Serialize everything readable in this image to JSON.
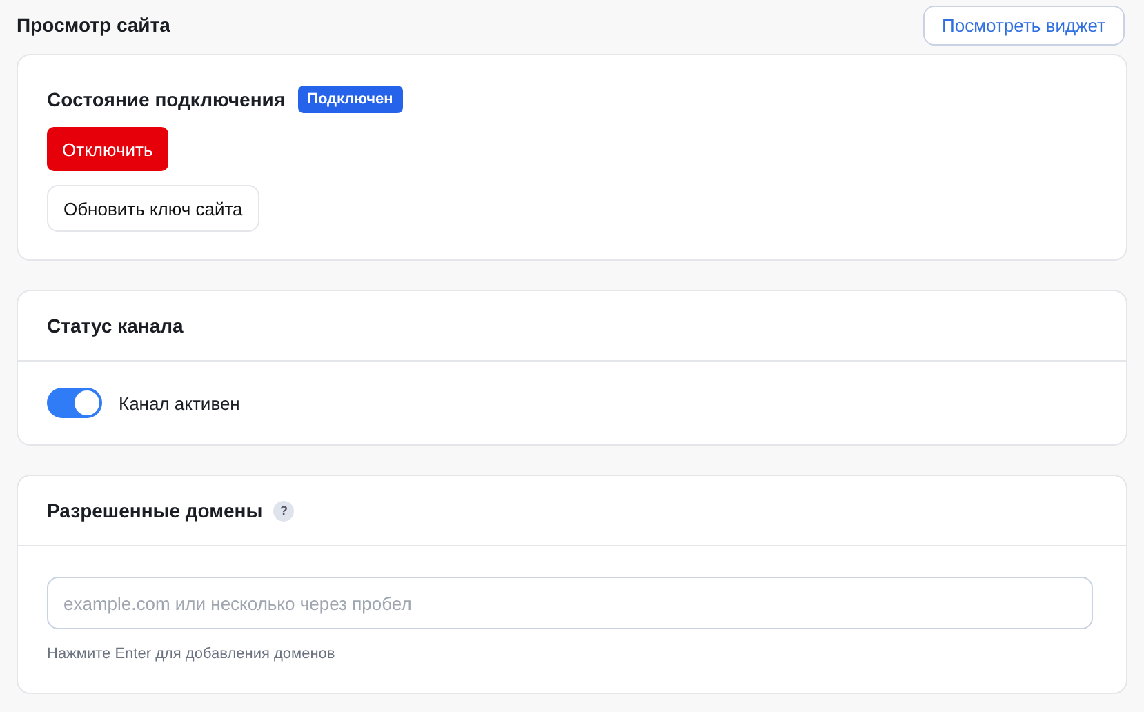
{
  "page": {
    "title": "Просмотр сайта",
    "action": "Посмотреть виджет"
  },
  "connection": {
    "title": "Состояние подключения",
    "badge": "Подключен",
    "disconnect": "Отключить",
    "refresh": "Обновить ключ сайта"
  },
  "channel": {
    "title": "Статус канала",
    "toggle": {
      "label": "Канал активен",
      "on": true
    }
  },
  "domains": {
    "title": "Разрешенные домены",
    "help": "?",
    "placeholder": "example.com или несколько через пробел",
    "hint": "Нажмите Enter для добавления доменов"
  }
}
